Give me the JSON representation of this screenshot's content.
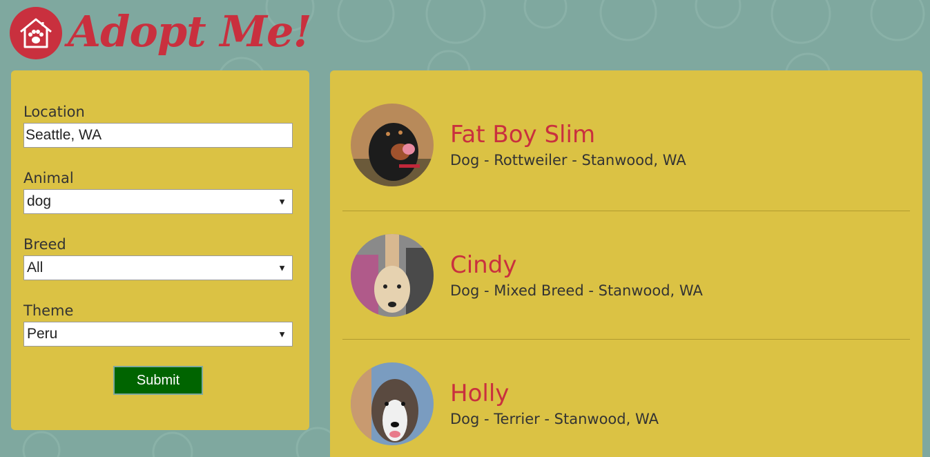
{
  "header": {
    "logo_text": "Adopt Me!",
    "logo_icon": "house-paw-icon",
    "brand_color": "#c9303e"
  },
  "colors": {
    "background": "#7fa89f",
    "panel": "#dbc244",
    "submit": "#006400"
  },
  "search_form": {
    "location_label": "Location",
    "location_value": "Seattle, WA",
    "animal_label": "Animal",
    "animal_value": "dog",
    "breed_label": "Breed",
    "breed_value": "All",
    "theme_label": "Theme",
    "theme_value": "Peru",
    "submit_label": "Submit"
  },
  "results": [
    {
      "name": "Fat Boy Slim",
      "description": "Dog - Rottweiler - Stanwood, WA"
    },
    {
      "name": "Cindy",
      "description": "Dog - Mixed Breed - Stanwood, WA"
    },
    {
      "name": "Holly",
      "description": "Dog - Terrier - Stanwood, WA"
    }
  ]
}
